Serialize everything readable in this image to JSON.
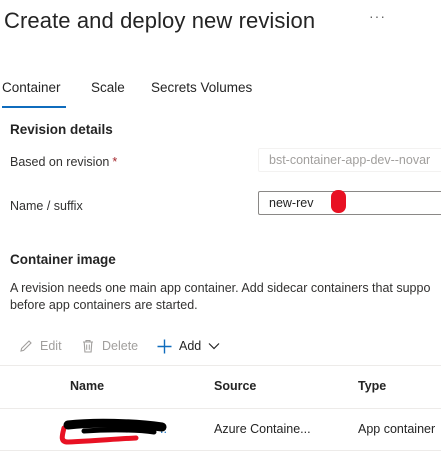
{
  "header": {
    "title": "Create and deploy new revision",
    "more_label": "···"
  },
  "tabs": [
    {
      "label": "Container",
      "active": true
    },
    {
      "label": "Scale",
      "active": false
    },
    {
      "label": "Secrets Volumes",
      "active": false
    }
  ],
  "revision_details": {
    "heading": "Revision details",
    "based_on_label": "Based on revision",
    "required_mark": "*",
    "based_on_value": "bst-container-app-dev--novar",
    "name_suffix_label": "Name / suffix",
    "name_suffix_value": "new-rev"
  },
  "container_image": {
    "heading": "Container image",
    "description_line1": "A revision needs one main app container. Add sidecar containers that suppo",
    "description_line2": "before app containers are started."
  },
  "toolbar": {
    "edit_label": "Edit",
    "delete_label": "Delete",
    "add_label": "Add"
  },
  "table": {
    "columns": [
      "Name",
      "Source",
      "Type"
    ],
    "rows": [
      {
        "name": "..",
        "source": "Azure Containe...",
        "type": "App container"
      }
    ]
  },
  "colors": {
    "accent": "#0f6cbd",
    "annotation_red": "#e81123",
    "redaction_black": "#000000"
  }
}
